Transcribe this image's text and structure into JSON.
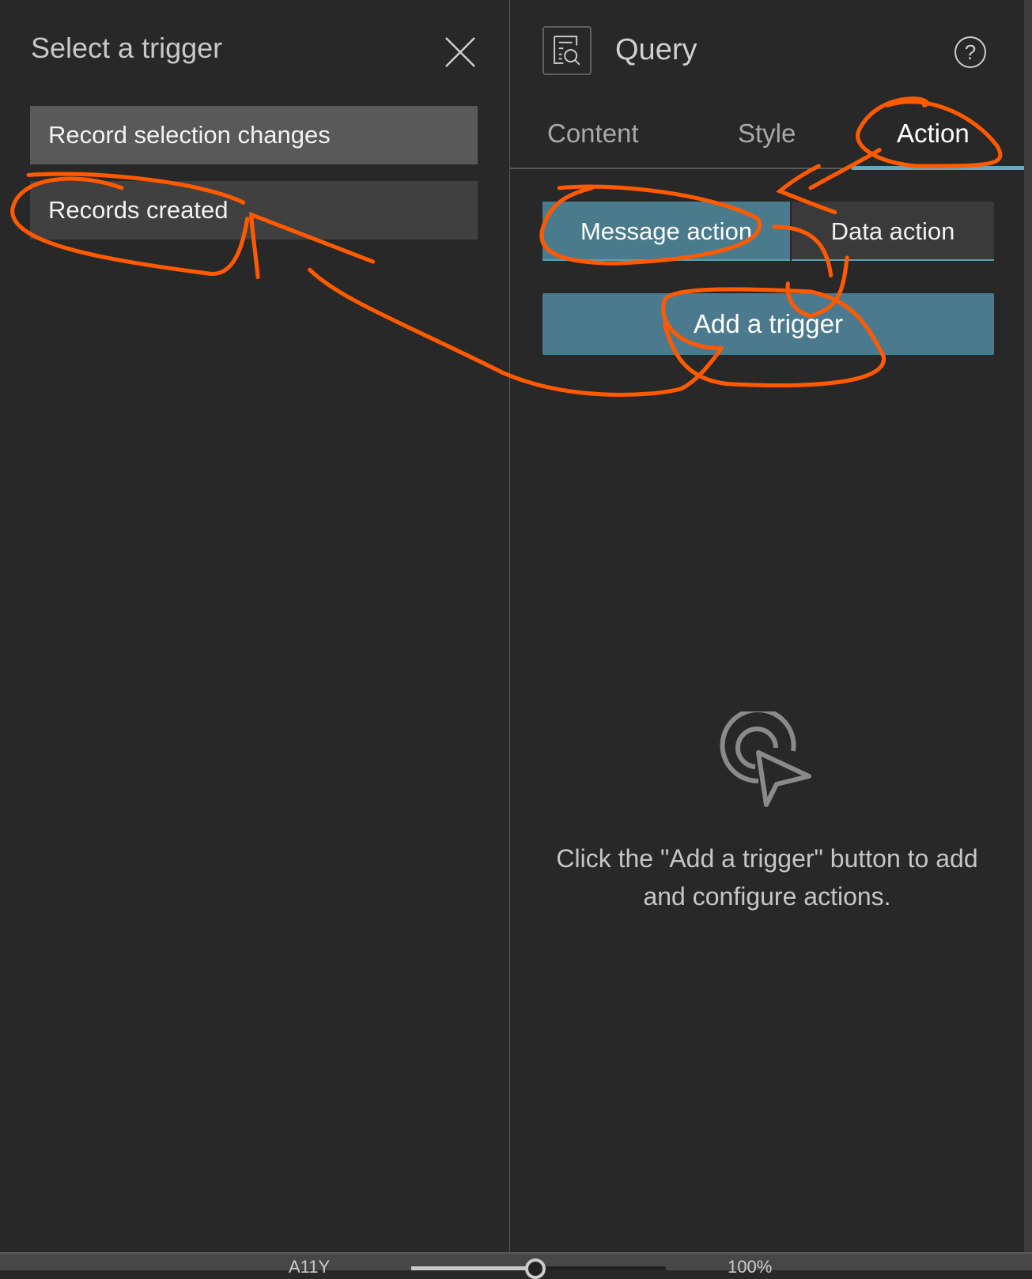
{
  "left_panel": {
    "title": "Select a trigger",
    "close_icon": "close-icon",
    "triggers": [
      {
        "label": "Record selection changes"
      },
      {
        "label": "Records created"
      }
    ]
  },
  "right_panel": {
    "widget_icon": "query-icon",
    "title": "Query",
    "help_icon": "help-icon",
    "tabs": [
      {
        "label": "Content"
      },
      {
        "label": "Style"
      },
      {
        "label": "Action",
        "active": true
      }
    ],
    "segments": [
      {
        "label": "Message action",
        "active": true
      },
      {
        "label": "Data action"
      }
    ],
    "add_trigger_label": "Add a trigger",
    "empty_icon": "cursor-target-icon",
    "hint": "Click the \"Add a trigger\" button to add and configure actions."
  },
  "status_bar": {
    "a11y_label": "A11Y",
    "zoom": "100%"
  },
  "colors": {
    "accent": "#4b7a8f",
    "annotation": "#ff5a00"
  }
}
